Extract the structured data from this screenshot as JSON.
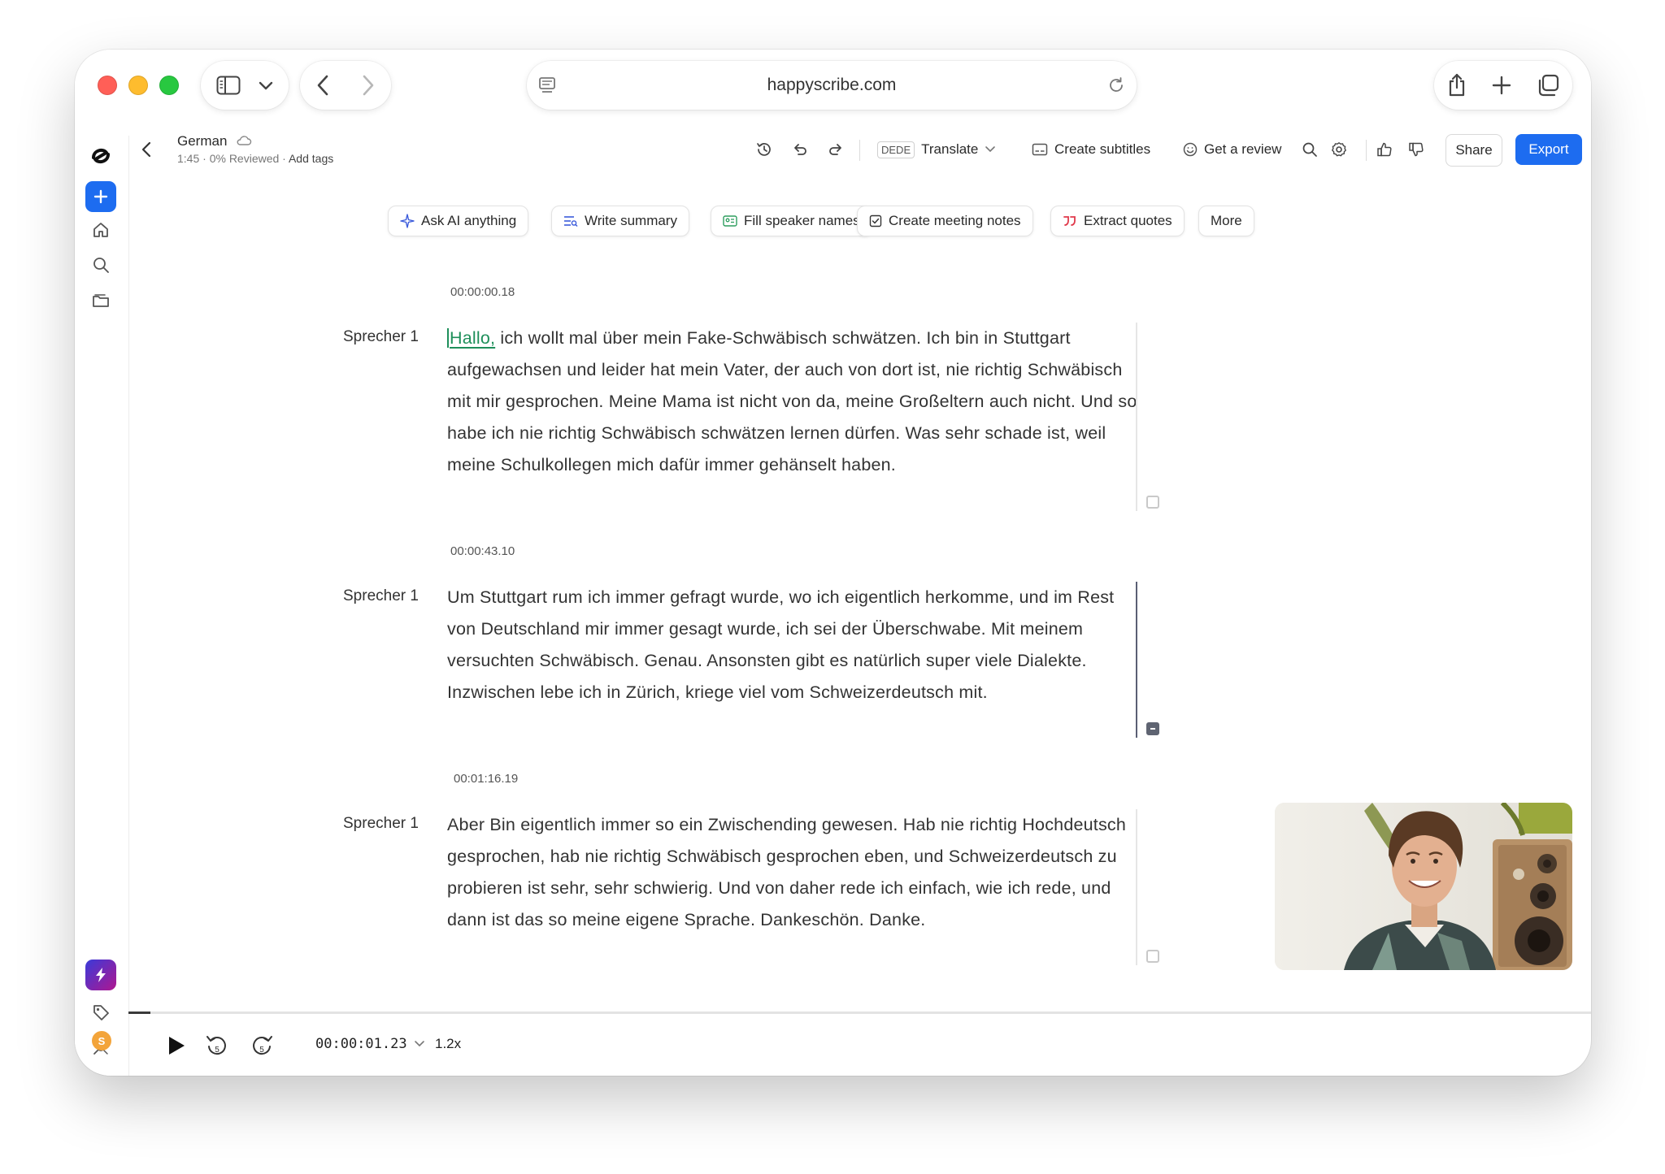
{
  "browser": {
    "url": "happyscribe.com"
  },
  "doc": {
    "title": "German",
    "meta": "1:45 · 0% Reviewed · ",
    "add_tags": "Add tags"
  },
  "toolbar": {
    "lang_chip": "DEDE",
    "translate": "Translate",
    "create_subtitles": "Create subtitles",
    "get_review": "Get a review",
    "share": "Share",
    "export": "Export"
  },
  "ai_actions": {
    "ask_ai": "Ask AI anything",
    "write_summary": "Write summary",
    "fill_speakers": "Fill speaker names",
    "meeting_notes": "Create meeting notes",
    "extract_quotes": "Extract quotes",
    "more": "More"
  },
  "transcript": [
    {
      "timestamp": "00:00:00.18",
      "speaker": "Sprecher 1",
      "first_word": "Hallo,",
      "text": " ich wollt mal über mein Fake-Schwäbisch schwätzen. Ich bin in Stuttgart aufgewachsen und leider hat mein Vater, der auch von dort ist, nie richtig Schwäbisch mit mir gesprochen. Meine Mama ist nicht von da, meine Großeltern auch nicht. Und so habe ich nie richtig Schwäbisch schwätzen lernen dürfen. Was sehr schade ist, weil meine Schulkollegen mich dafür immer gehänselt haben.",
      "checked": false
    },
    {
      "timestamp": "00:00:43.10",
      "speaker": "Sprecher 1",
      "text": "Um Stuttgart rum ich immer gefragt wurde, wo ich eigentlich herkomme, und im Rest von Deutschland mir immer gesagt wurde, ich sei der Überschwabe. Mit meinem versuchten Schwäbisch. Genau. Ansonsten gibt es natürlich super viele Dialekte. Inzwischen lebe ich in Zürich, kriege viel vom Schweizerdeutsch mit.",
      "checked": "partial"
    },
    {
      "timestamp": "00:01:16.19",
      "speaker": "Sprecher 1",
      "text": "Aber Bin eigentlich immer so ein Zwischending gewesen. Hab nie richtig Hochdeutsch gesprochen, hab nie richtig Schwäbisch gesprochen eben, und Schweizerdeutsch zu probieren ist sehr, sehr schwierig. Und von daher rede ich einfach, wie ich rede, und dann ist das so meine eigene Sprache. Dankeschön. Danke.",
      "checked": false
    }
  ],
  "player": {
    "current_time": "00:00:01.23",
    "speed": "1.2x",
    "skip_back": "5",
    "skip_forward": "5",
    "progress_fraction": 0.015
  },
  "rail": {
    "avatar_initial": "S"
  },
  "colors": {
    "accent": "#1d6cf0",
    "highlight": "#1e8f5a",
    "quote_red": "#e0384a"
  }
}
